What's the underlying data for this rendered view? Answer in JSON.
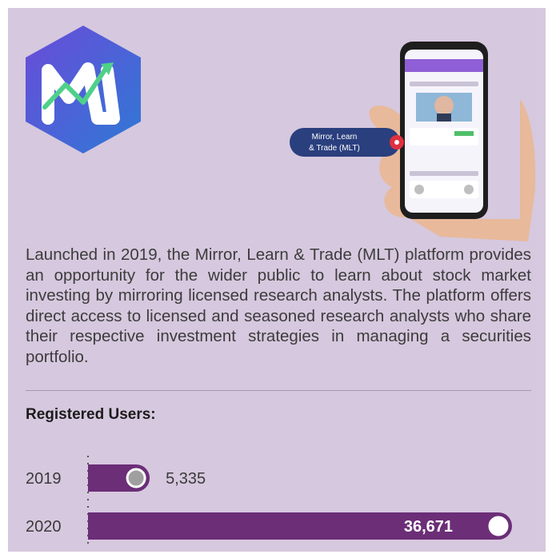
{
  "callout": {
    "label_line1": "Mirror, Learn",
    "label_line2": "& Trade (MLT)"
  },
  "description": "Launched in 2019, the Mirror, Learn & Trade (MLT) platform provides an opportunity for the wider public to learn about stock market investing by mirroring licensed research analysts. The platform offers direct access to licensed and seasoned research analysts who share their respective investment strategies in managing a securities portfolio.",
  "section": {
    "title": "Registered Users:"
  },
  "chart_data": {
    "type": "bar",
    "orientation": "horizontal",
    "categories": [
      "2019",
      "2020"
    ],
    "values": [
      5335,
      36671
    ],
    "value_labels": [
      "5,335",
      "36,671"
    ],
    "title": "Registered Users:",
    "xlim": [
      0,
      36671
    ]
  },
  "colors": {
    "background": "#d6c8de",
    "bar": "#6b2e77",
    "marker": "#ffffff",
    "marker_2019": "#9f9f9f",
    "logo_gradient_start": "#6a4bd8",
    "logo_gradient_end": "#2f79d6",
    "callout": "#2a3f7e",
    "callout_badge": "#e03040"
  },
  "icons": {
    "logo": "mlt-logo-icon",
    "phone": "phone-in-hand-icon"
  }
}
